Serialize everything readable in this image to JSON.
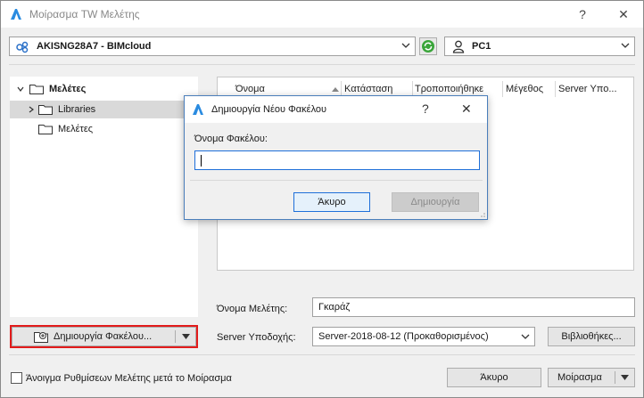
{
  "window": {
    "title": "Μοίρασμα TW Μελέτης",
    "help_label": "?",
    "close_label": "✕"
  },
  "server_combo": {
    "value": "AKISNG28A7 - BIMcloud"
  },
  "client_combo": {
    "value": "PC1"
  },
  "tree": {
    "items": [
      {
        "label": "Μελέτες"
      },
      {
        "label": "Libraries"
      },
      {
        "label": "Μελέτες"
      }
    ]
  },
  "list": {
    "columns": [
      "Όνομα",
      "Κατάσταση",
      "Τροποποιήθηκε",
      "Μέγεθος",
      "Server Υπο..."
    ]
  },
  "project_name": {
    "label": "Όνομα Μελέτης:",
    "value": "Γκαράζ"
  },
  "server_support": {
    "label": "Server Υποδοχής:",
    "value": "Server-2018-08-12 (Προκαθορισμένος)"
  },
  "buttons": {
    "new_folder": "Δημιουργία Φακέλου...",
    "libraries": "Βιβλιοθήκες...",
    "cancel": "Άκυρο",
    "share": "Μοίρασμα"
  },
  "open_settings_checkbox": {
    "label": "Άνοιγμα Ρυθμίσεων Μελέτης μετά το Μοίρασμα",
    "checked": false
  },
  "dialog": {
    "title": "Δημιουργία Νέου Φακέλου",
    "help_label": "?",
    "close_label": "✕",
    "folder_name_label": "Όνομα Φακέλου:",
    "folder_name_value": "",
    "cancel": "Άκυρο",
    "create": "Δημιουργία"
  },
  "colors": {
    "accent": "#1e6fd9",
    "highlight": "#e21b1b",
    "selected_row": "#d9d9d9"
  }
}
